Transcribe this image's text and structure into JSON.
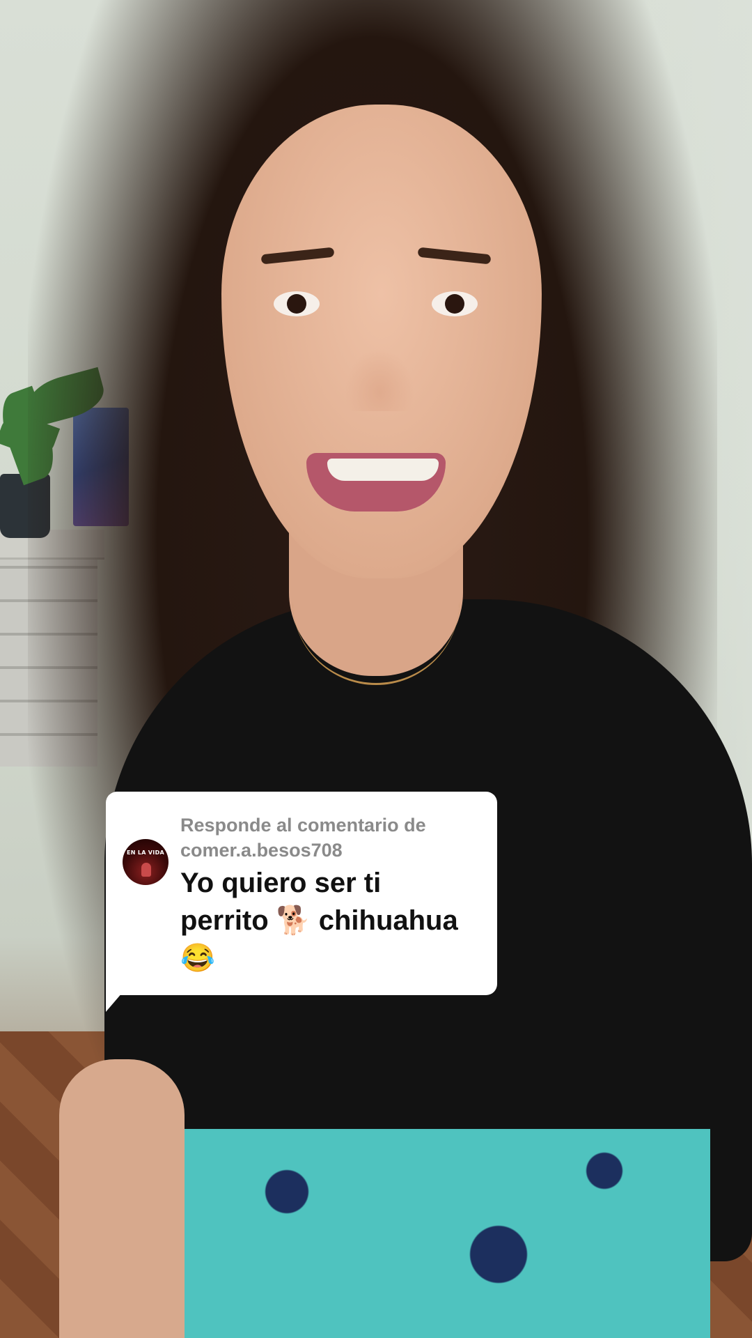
{
  "reply_sticker": {
    "prefix": "Responde al comentario de",
    "username": "comer.a.besos708",
    "avatar_text": "EN LA VIDA",
    "comment_line_1": "Yo quiero ser ti",
    "comment_line_2": "perrito 🐕 chihuahua",
    "comment_line_3": "😂"
  },
  "colors": {
    "card_background": "#ffffff",
    "meta_text": "#8a8a8a",
    "comment_text": "#111111"
  }
}
